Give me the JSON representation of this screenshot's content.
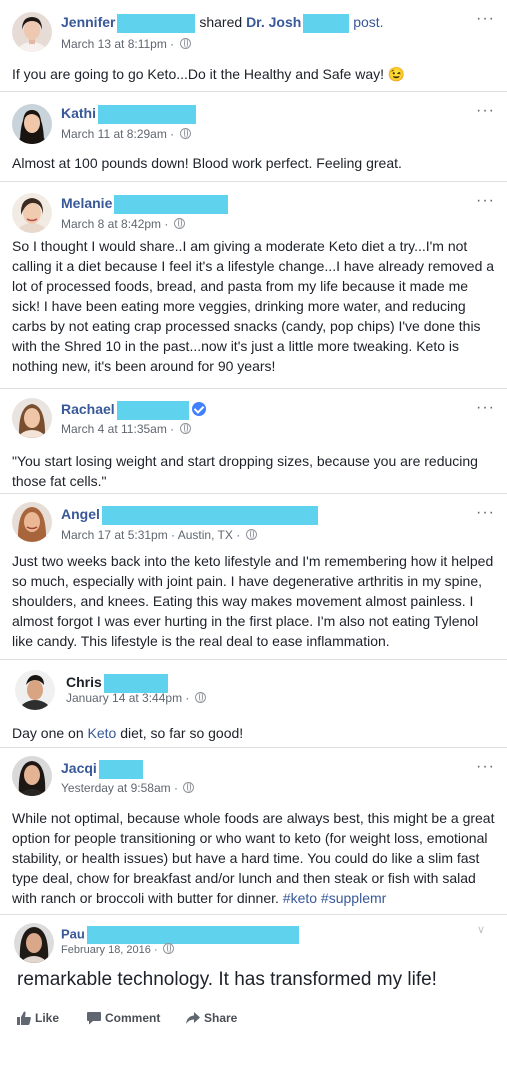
{
  "posts": [
    {
      "name": "Jennifer",
      "shared_text": "shared",
      "shared_name": "Dr. Josh",
      "shared_suffix": "post.",
      "time": "March 13 at 8:11pm ·",
      "text": "If you are going to go Keto...Do it the Healthy and Safe way! 😉"
    },
    {
      "name": "Kathi",
      "time": "March 11 at 8:29am ·",
      "text": "Almost at 100 pounds down! Blood work perfect. Feeling great."
    },
    {
      "name": "Melanie",
      "time": "March 8 at 8:42pm ·",
      "text": "So I thought I would share..I am giving a moderate Keto diet a try...I'm not calling it a diet because I feel it's a lifestyle change...I have already removed a lot of processed foods, bread, and pasta from my life because it made me sick! I have been eating more veggies, drinking more water, and reducing carbs by not eating crap processed snacks (candy, pop chips) I've done this with the Shred 10 in the past...now it's just a little more tweaking. Keto is nothing new, it's been around for 90 years!"
    },
    {
      "name": "Rachael",
      "time": "March 4 at 11:35am ·",
      "text": "\"You start losing weight and start dropping sizes, because you are reducing those fat cells.\""
    },
    {
      "name": "Angel",
      "time": "March 17 at 5:31pm · Austin, TX ·",
      "text": "Just two weeks back into the keto lifestyle and I'm remembering how it helped so much, especially with joint pain. I have degenerative arthritis in my spine, shoulders, and knees. Eating this way makes movement almost painless. I almost forgot I was ever hurting in the first place. I'm also not eating Tylenol like candy. This lifestyle is the real deal to ease inflammation."
    },
    {
      "name": "Chris",
      "time": "January 14 at 3:44pm ·",
      "text_before": "Day one on ",
      "text_link": "Keto",
      "text_after": " diet, so far so good!"
    },
    {
      "name": "Jacqi",
      "time": "Yesterday at 9:58am ·",
      "text": "While not optimal, because whole foods are always best, this might be a great option for people transitioning or who want to keto (for weight loss, emotional stability, or health issues) but have a hard time. You could do like a slim fast type deal, chow for breakfast and/or lunch and then steak or fish with salad with ranch or broccoli with butter for dinner.",
      "tags": "#keto #supplemr"
    },
    {
      "name": "Pau",
      "time": "February 18, 2016 ·",
      "text": "remarkable technology. It has transformed my life!"
    }
  ],
  "actions": {
    "like": "Like",
    "comment": "Comment",
    "share": "Share"
  },
  "more_icon": "···",
  "chevron_icon": "∨",
  "colors": {
    "redaction": "#5fd2ee",
    "link": "#385898",
    "text": "#1d2129",
    "meta": "#606770"
  }
}
